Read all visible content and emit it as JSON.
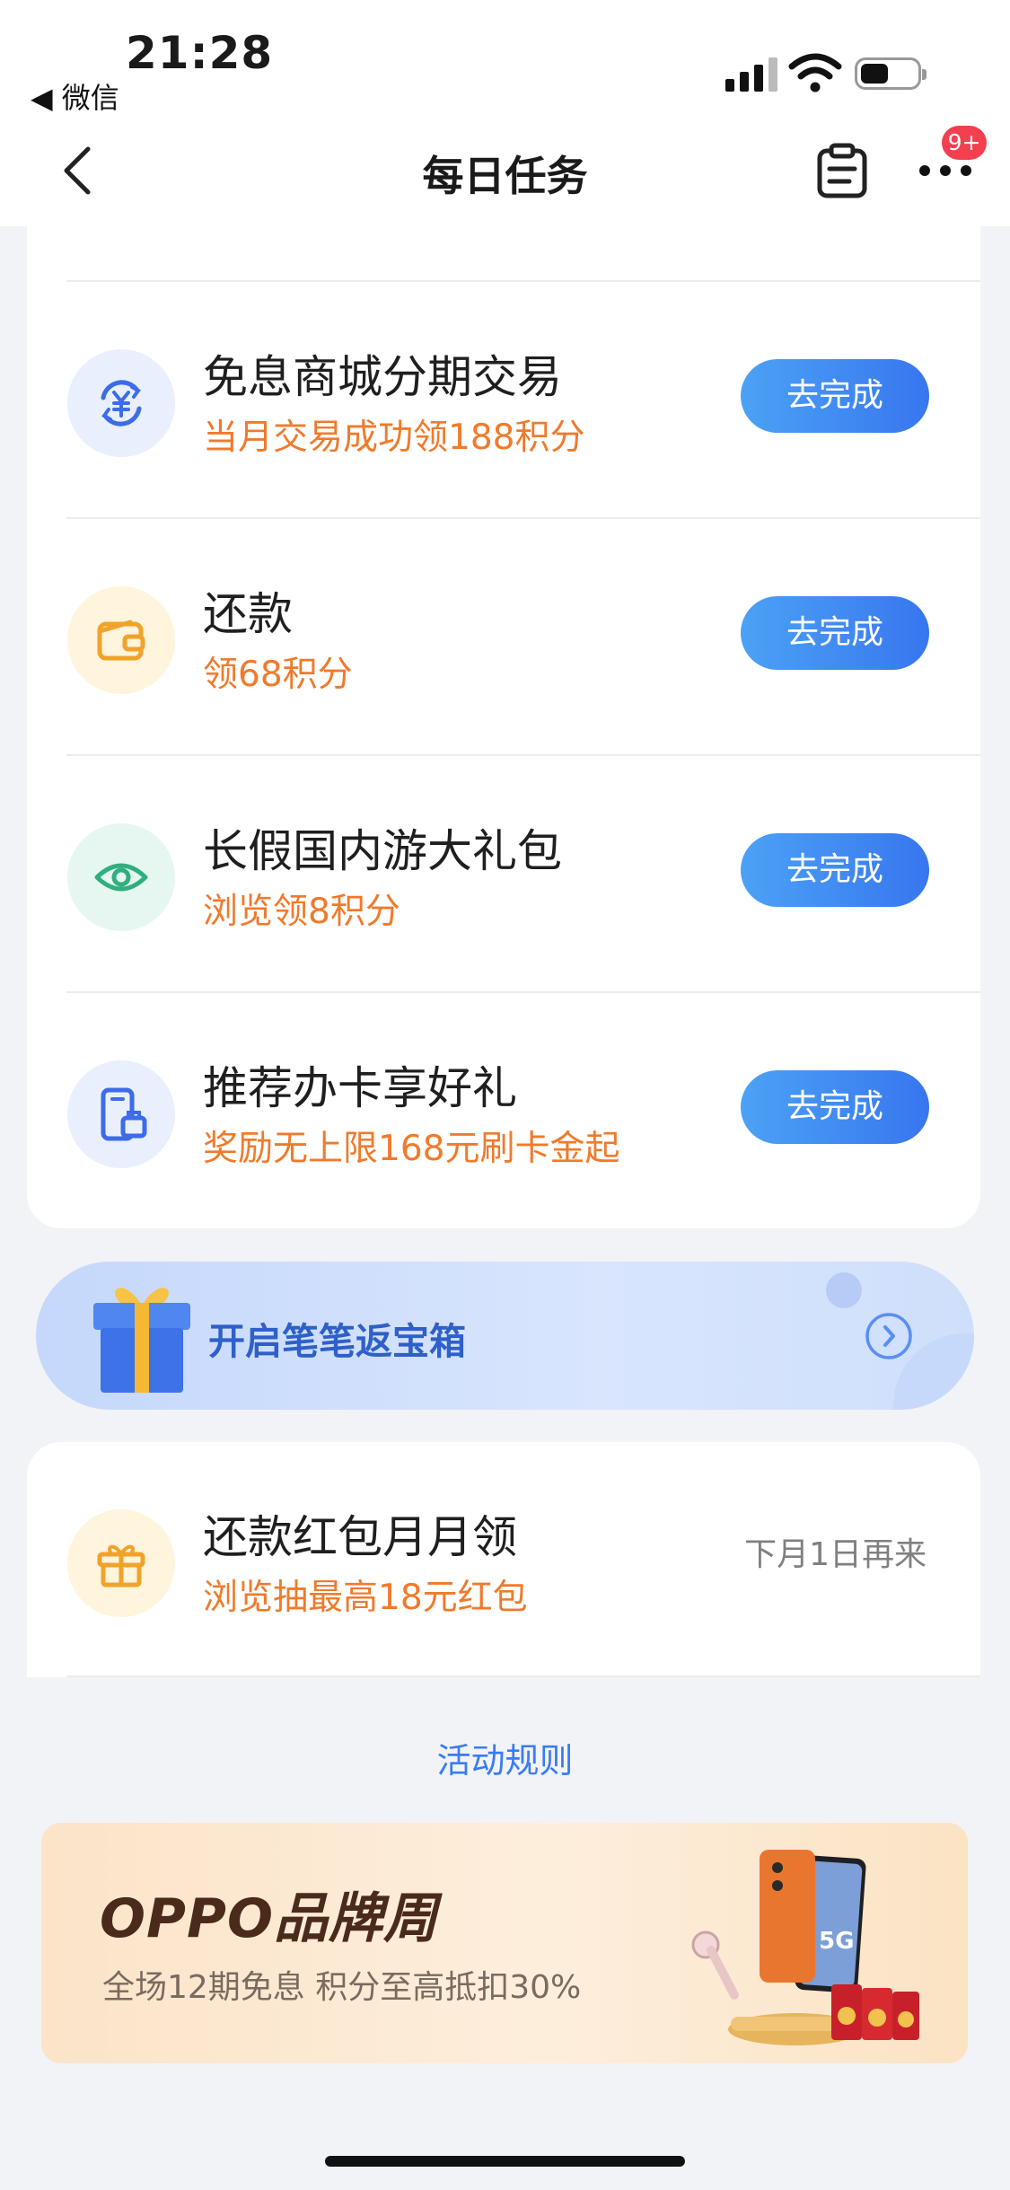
{
  "status_bar": {
    "time": "21:28",
    "back_app": "◀ 微信"
  },
  "nav": {
    "title": "每日任务",
    "badge": "9+"
  },
  "tasks": [
    {
      "title": "免息商城分期交易",
      "subtitle": "当月交易成功领188积分",
      "button": "去完成",
      "icon": "yuan-exchange-icon",
      "icon_bg": "#e9effd",
      "icon_color": "#3c6ce8"
    },
    {
      "title": "还款",
      "subtitle": "领68积分",
      "button": "去完成",
      "icon": "wallet-icon",
      "icon_bg": "#fff4dc",
      "icon_color": "#f0a32a"
    },
    {
      "title": "长假国内游大礼包",
      "subtitle": "浏览领8积分",
      "button": "去完成",
      "icon": "eye-icon",
      "icon_bg": "#e5f7f0",
      "icon_color": "#2faf7e"
    },
    {
      "title": "推荐办卡享好礼",
      "subtitle": "奖励无上限168元刷卡金起",
      "button": "去完成",
      "icon": "phone-card-icon",
      "icon_bg": "#e9effd",
      "icon_color": "#3c6ce8"
    }
  ],
  "treasure_banner": {
    "label": "开启笔笔返宝箱"
  },
  "red_packet_task": {
    "title": "还款红包月月领",
    "subtitle": "浏览抽最高18元红包",
    "status": "下月1日再来",
    "icon": "gift-icon"
  },
  "rules_link": "活动规则",
  "promo": {
    "title": "OPPO品牌周",
    "subtitle": "全场12期免息  积分至高抵扣30%"
  },
  "colors": {
    "accent_blue": "#3a7cf2",
    "orange_text": "#f07a2b",
    "badge_red": "#f43f4e"
  }
}
